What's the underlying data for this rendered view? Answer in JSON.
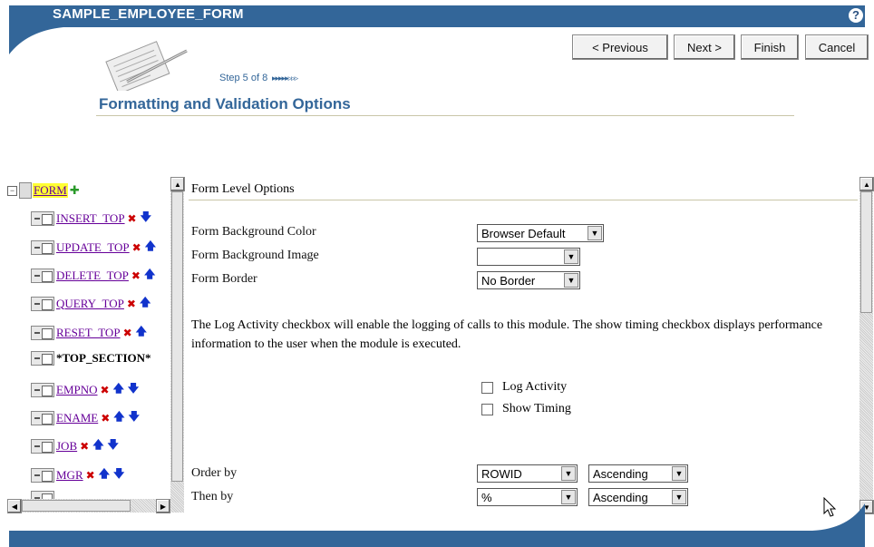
{
  "header": {
    "title": "SAMPLE_EMPLOYEE_FORM",
    "help_icon": "?",
    "step_text": "Step 5 of 8",
    "step_progress": "▸▸▸▸▸▹▹▹",
    "page_title": "Formatting and Validation Options"
  },
  "nav": {
    "previous": "< Previous",
    "next": "Next >",
    "finish": "Finish",
    "cancel": "Cancel"
  },
  "tree": {
    "root": "FORM",
    "items": [
      {
        "label": "INSERT_TOP"
      },
      {
        "label": "UPDATE_TOP"
      },
      {
        "label": "DELETE_TOP"
      },
      {
        "label": "QUERY_TOP"
      },
      {
        "label": "RESET_TOP"
      },
      {
        "label": "*TOP_SECTION*"
      },
      {
        "label": "EMPNO"
      },
      {
        "label": "ENAME"
      },
      {
        "label": "JOB"
      },
      {
        "label": "MGR"
      }
    ]
  },
  "main": {
    "section_title": "Form Level Options",
    "bg_color_label": "Form Background Color",
    "bg_color_value": "Browser Default",
    "bg_image_label": "Form Background Image",
    "bg_image_value": "",
    "border_label": "Form Border",
    "border_value": "No Border",
    "log_description": "The Log Activity checkbox will enable the logging of calls to this module. The show timing checkbox displays performance information to the user when the module is executed.",
    "log_activity_label": "Log Activity",
    "show_timing_label": "Show Timing",
    "order_by_label": "Order by",
    "order_by_value": "ROWID",
    "order_by_dir": "Ascending",
    "then_by_label": "Then by",
    "then_by_value": "%",
    "then_by_dir": "Ascending"
  },
  "colors": {
    "brand": "#336699",
    "link": "#660099",
    "delete": "#cc0000",
    "move": "#1133cc",
    "root_highlight": "#ffff33"
  },
  "icons": [
    "help-icon",
    "notepad-pencil-icon",
    "plus-icon",
    "delete-x-icon",
    "up-arrow-icon",
    "down-arrow-icon",
    "dropdown-arrow-icon",
    "mouse-cursor-icon"
  ]
}
